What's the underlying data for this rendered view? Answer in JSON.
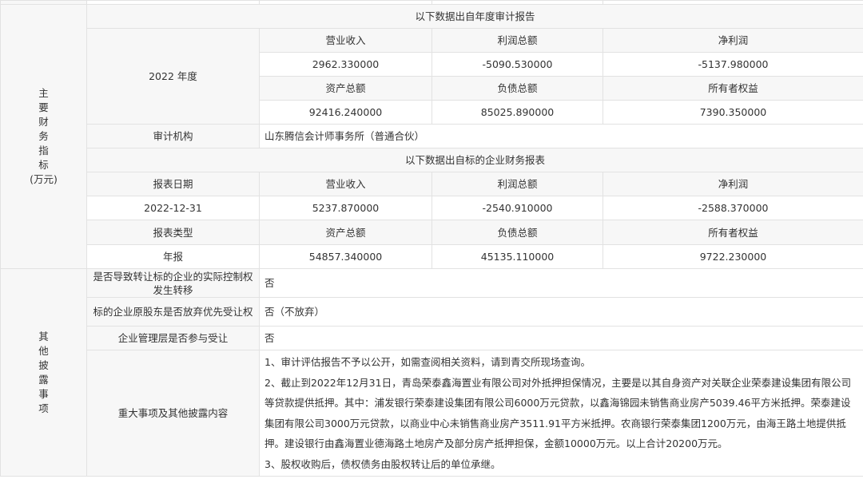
{
  "financial": {
    "section_label_chars": [
      "主",
      "要",
      "财",
      "务",
      "指",
      "标"
    ],
    "section_unit": "(万元)",
    "audit": {
      "header": "以下数据出自年度审计报告",
      "year_label": "2022 年度",
      "row1_labels": [
        "营业收入",
        "利润总额",
        "净利润"
      ],
      "row1_values": [
        "2962.330000",
        "-5090.530000",
        "-5137.980000"
      ],
      "row2_labels": [
        "资产总额",
        "负债总额",
        "所有者权益"
      ],
      "row2_values": [
        "92416.240000",
        "85025.890000",
        "7390.350000"
      ],
      "auditor_label": "审计机构",
      "auditor_value": "山东腾信会计师事务所（普通合伙）"
    },
    "report": {
      "header": "以下数据出自标的企业财务报表",
      "date_label": "报表日期",
      "row1_labels": [
        "营业收入",
        "利润总额",
        "净利润"
      ],
      "date_value": "2022-12-31",
      "row1_values": [
        "5237.870000",
        "-2540.910000",
        "-2588.370000"
      ],
      "type_label": "报表类型",
      "row2_labels": [
        "资产总额",
        "负债总额",
        "所有者权益"
      ],
      "type_value": "年报",
      "row2_values": [
        "54857.340000",
        "45135.110000",
        "9722.230000"
      ]
    }
  },
  "other": {
    "section_label_chars": [
      "其",
      "他",
      "披",
      "露",
      "事",
      "项"
    ],
    "q1_label": "是否导致转让标的企业的实际控制权发生转移",
    "q1_value": "否",
    "q2_label": "标的企业原股东是否放弃优先受让权",
    "q2_value": "否（不放弃）",
    "q3_label": "企业管理层是否参与受让",
    "q3_value": "否",
    "q4_label": "重大事项及其他披露内容",
    "q4_paragraphs": [
      "1、审计评估报告不予以公开，如需查阅相关资料，请到青交所现场查询。",
      "2、截止到2022年12月31日，青岛荣泰鑫海置业有限公司对外抵押担保情况，主要是以其自身资产对关联企业荣泰建设集团有限公司等贷款提供抵押。其中：浦发银行荣泰建设集团有限公司6000万元贷款，以鑫海锦园未销售商业房产5039.46平方米抵押。荣泰建设集团有限公司3000万元贷款，以商业中心未销售商业房产3511.91平方米抵押。农商银行荣泰集团1200万元，由海王路土地提供抵押。建设银行由鑫海置业德海路土地房产及部分房产抵押担保，金额10000万元。以上合计20200万元。",
      "3、股权收购后，债权债务由股权转让后的单位承继。"
    ]
  }
}
